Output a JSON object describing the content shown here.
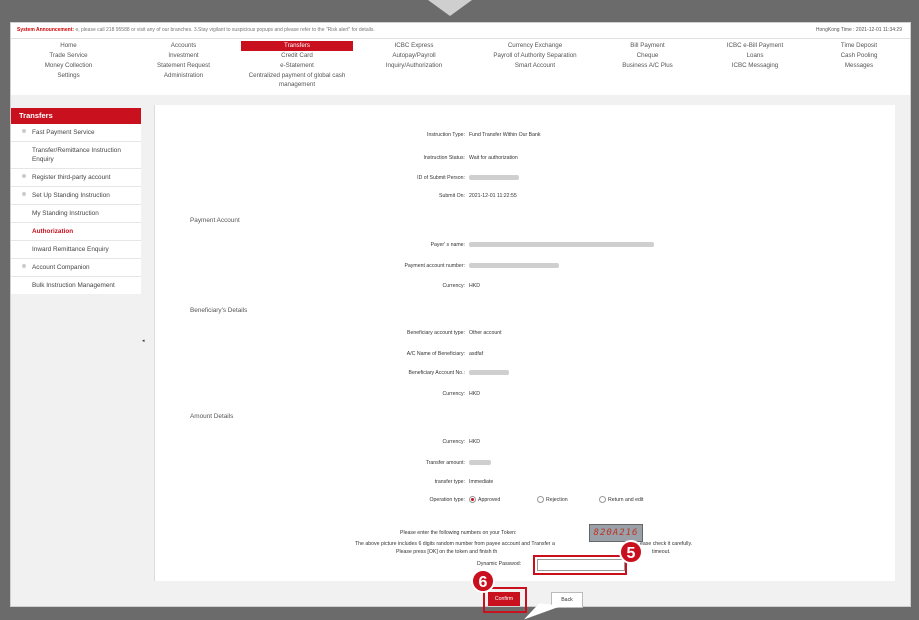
{
  "announcement": {
    "label": "System Announcement:",
    "text": "e, please call 218 95588 or visit any of our branches. 3.Stay vigilant to suspicious popups and please refer to the \"Risk alert\" for details.",
    "time": "HongKong Time : 2021-12-01 11:34:29"
  },
  "menu": {
    "row1": [
      "Home",
      "Accounts",
      "Transfers",
      "ICBC Express",
      "Currency Exchange",
      "Bill Payment",
      "ICBC e-Bill Payment",
      "Time Deposit"
    ],
    "row2": [
      "Trade Service",
      "Investment",
      "Credit Card",
      "Autopay/Payroll",
      "Payroll of Authority Separation",
      "Cheque",
      "Loans",
      "Cash Pooling"
    ],
    "row3": [
      "Money Collection",
      "Statement Request",
      "e-Statement",
      "Inquiry/Authorization",
      "Smart Account",
      "Business A/C Plus",
      "ICBC Messaging",
      "Messages"
    ],
    "row4": [
      "Settings",
      "Administration",
      "Centralized payment of global cash management"
    ]
  },
  "sidebar": {
    "title": "Transfers",
    "items": [
      "Fast Payment Service",
      "Transfer/Remittance Instruction Enquiry",
      "Register third-party account",
      "Set Up Standing Instruction",
      "My Standing Instruction",
      "Authorization",
      "Inward Remittance Enquiry",
      "Account Companion",
      "Bulk Instruction Management"
    ],
    "collapse_arrow": "◂"
  },
  "detail": {
    "instruction_type_label": "Instruction Type:",
    "instruction_type_value": "Fund Transfer Within Our Bank",
    "status_label": "Instruction Status:",
    "status_value": "Wait for authorization",
    "submitter_label": "ID of Submit Person:",
    "submit_on_label": "Submit On:",
    "submit_on_value": "2021-12-01 11:22:55"
  },
  "payment_account": {
    "section": "Payment Account",
    "payer_label": "Payer' s name:",
    "account_label": "Payment account number:",
    "currency_label": "Currency:",
    "currency_value": "HKD"
  },
  "beneficiary": {
    "section": "Beneficiary's Details",
    "type_label": "Beneficiary account type:",
    "type_value": "Other account",
    "name_label": "A/C Name of Beneficiary:",
    "name_value": "asdfaf",
    "account_label": "Beneficiary Account No.:",
    "currency_label": "Currency:",
    "currency_value": "HKD"
  },
  "amount": {
    "section": "Amount Details",
    "currency_label": "Currency:",
    "currency_value": "HKD",
    "amount_label": "Transfer amount:",
    "type_label": "transfer type:",
    "type_value": "Immediate",
    "op_label": "Operation type:",
    "op_approved": "Approved",
    "op_rejection": "Rejection",
    "op_return": "Return and edit"
  },
  "token": {
    "line1": "Please enter the following numbers on your Token:",
    "code": "820A216",
    "line2": "The above picture includes 6 digits random number from payee account and Transfer a",
    "line2b": "ease check it carefully.",
    "line3": "Please press [OK] on the token and finish th",
    "line3b": "timeout.",
    "pwd_label": "Dynamic Passwo",
    "pwd_label_tail": "d:"
  },
  "buttons": {
    "confirm": "Confirm",
    "back": "Back"
  },
  "annotations": {
    "step5": "5",
    "step6": "6"
  },
  "colors": {
    "brand_red": "#c8101e"
  }
}
